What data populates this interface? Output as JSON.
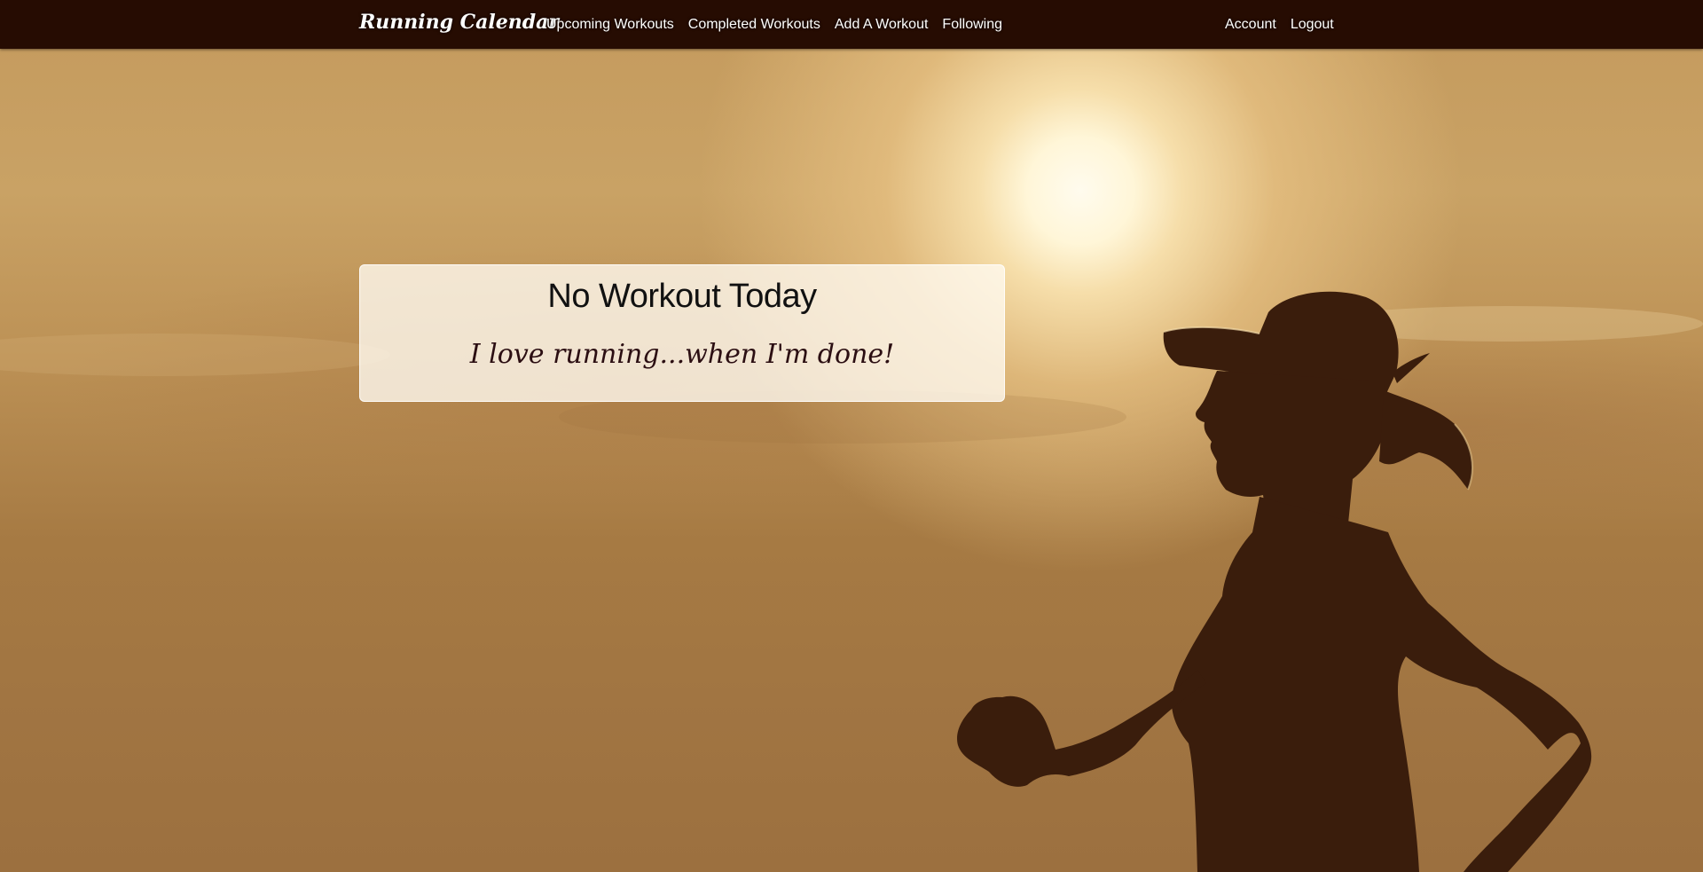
{
  "navbar": {
    "brand": "Running Calendar",
    "links": [
      "Upcoming Workouts",
      "Completed Workouts",
      "Add A Workout",
      "Following"
    ],
    "account_links": [
      "Account",
      "Logout"
    ]
  },
  "main": {
    "title": "No Workout Today",
    "quote": "I love running...when I'm done!"
  },
  "colors": {
    "navbar_bg": "#260c02",
    "card_bg": "#fffaf0",
    "quote_text": "#2b0e12"
  }
}
